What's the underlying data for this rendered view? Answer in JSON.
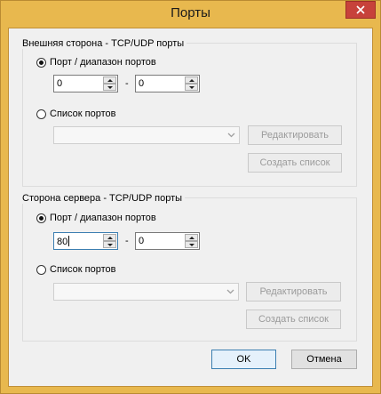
{
  "window": {
    "title": "Порты",
    "close_glyph": "✕"
  },
  "external": {
    "group_title": "Внешняя сторона - TCP/UDP порты",
    "range_label": "Порт / диапазон портов",
    "range_selected": true,
    "from_value": "0",
    "separator": "-",
    "to_value": "0",
    "list_label": "Список портов",
    "list_selected": false,
    "combo_value": "",
    "edit_button": "Редактировать",
    "create_button": "Создать список"
  },
  "server": {
    "group_title": "Сторона сервера - TCP/UDP порты",
    "range_label": "Порт / диапазон портов",
    "range_selected": true,
    "from_value": "80",
    "separator": "-",
    "to_value": "0",
    "list_label": "Список портов",
    "list_selected": false,
    "combo_value": "",
    "edit_button": "Редактировать",
    "create_button": "Создать список"
  },
  "footer": {
    "ok_button": "OK",
    "cancel_button": "Отмена"
  },
  "icons": {
    "close": "close-icon",
    "spin_up": "spin-up-icon",
    "spin_down": "spin-down-icon",
    "dropdown": "chevron-down-icon"
  },
  "colors": {
    "frame": "#e8b84e",
    "close": "#c7423b",
    "client": "#f0f0f0",
    "focus": "#3c7fb1"
  }
}
